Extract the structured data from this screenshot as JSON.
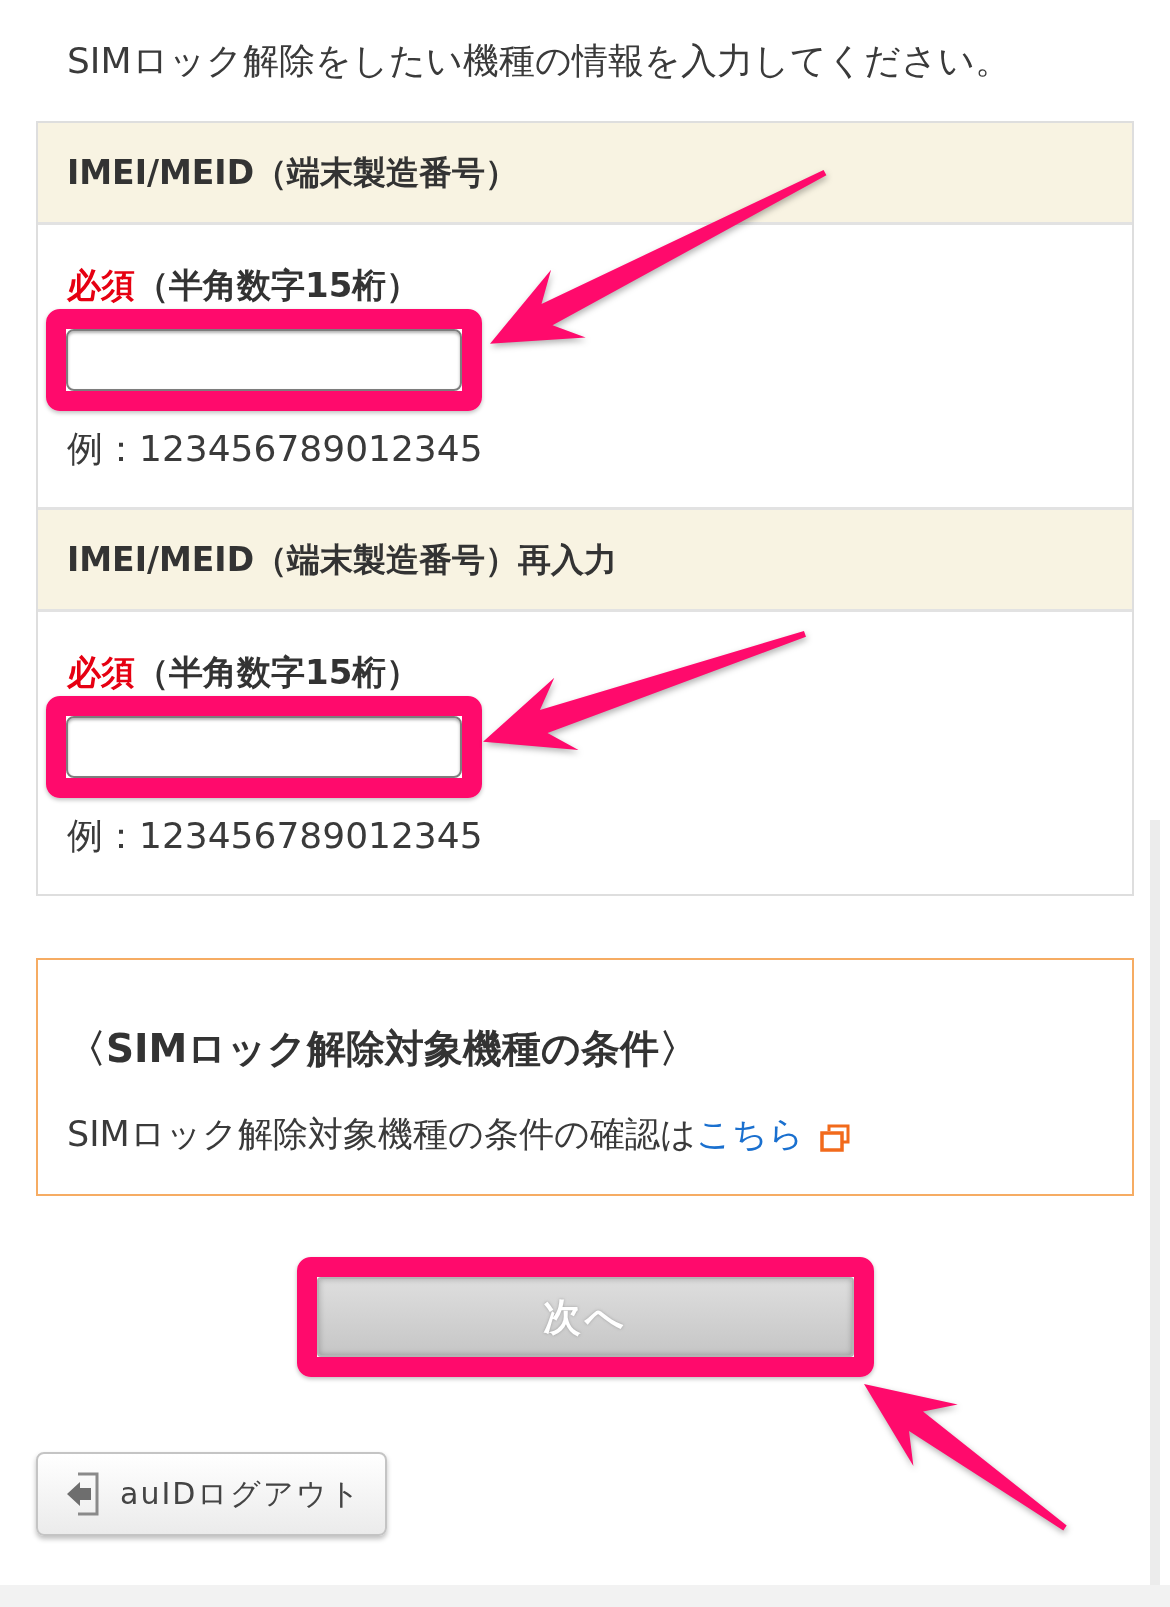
{
  "intro": "SIMロック解除をしたい機種の情報を入力してください。",
  "fields": [
    {
      "heading": "IMEI/MEID（端末製造番号）",
      "required_label": "必須",
      "hint": "（半角数字15桁）",
      "example": "例：123456789012345",
      "highlighted": true
    },
    {
      "heading": "IMEI/MEID（端末製造番号）再入力",
      "required_label": "必須",
      "hint": "（半角数字15桁）",
      "example": "例：123456789012345",
      "highlighted": true
    }
  ],
  "conditions": {
    "title": "〈SIMロック解除対象機種の条件〉",
    "text": "SIMロック解除対象機種の条件の確認は",
    "link": "こちら"
  },
  "next_button": {
    "label": "次へ",
    "disabled": true,
    "highlighted": true
  },
  "logout_button": {
    "label": "auIDログアウト"
  }
}
